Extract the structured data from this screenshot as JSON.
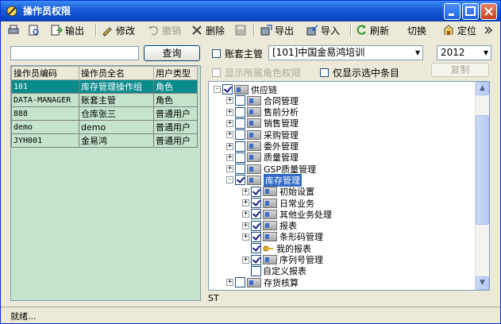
{
  "window": {
    "title": "操作员权限"
  },
  "toolbar": {
    "items": [
      {
        "label": "",
        "icon": "printer-icon"
      },
      {
        "label": "",
        "icon": "preview-icon"
      },
      {
        "label": "输出",
        "icon": "output-icon"
      },
      {
        "label": "修改",
        "icon": "edit-icon"
      },
      {
        "label": "撤销",
        "icon": "undo-icon"
      },
      {
        "label": "删除",
        "icon": "delete-icon"
      },
      {
        "label": "",
        "icon": "save-icon"
      },
      {
        "label": "导出",
        "icon": "export-icon"
      },
      {
        "label": "导入",
        "icon": "import-icon"
      },
      {
        "label": "刷新",
        "icon": "refresh-icon"
      },
      {
        "label": "切换",
        "icon": ""
      },
      {
        "label": "定位",
        "icon": "locate-icon"
      }
    ]
  },
  "left": {
    "search_value": "",
    "search_button": "查询",
    "columns": [
      "操作员编码",
      "操作员全名",
      "用户类型"
    ],
    "rows": [
      [
        "101",
        "库存管理操作组",
        "角色"
      ],
      [
        "DATA-MANAGER",
        "账套主管",
        "角色"
      ],
      [
        "888",
        "仓库张三",
        "普通用户"
      ],
      [
        "demo",
        "demo",
        "普通用户"
      ],
      [
        "JYH001",
        "金易鸿",
        "普通用户"
      ]
    ],
    "selected_index": 0
  },
  "right": {
    "account_master_label": "账套主管",
    "account_select": "[101]中国金易鸿培训",
    "year_select": "2012",
    "show_role_perms_label": "显示所属角色权限",
    "show_selected_only_label": "仅显示选中条目",
    "copy_button": "复制",
    "tree": [
      {
        "label": "供应链",
        "level": 0,
        "expander": "-",
        "checked": true
      },
      {
        "label": "合同管理",
        "level": 1,
        "expander": "+",
        "checked": false
      },
      {
        "label": "售前分析",
        "level": 1,
        "expander": "+",
        "checked": false
      },
      {
        "label": "销售管理",
        "level": 1,
        "expander": "+",
        "checked": false
      },
      {
        "label": "采购管理",
        "level": 1,
        "expander": "+",
        "checked": false
      },
      {
        "label": "委外管理",
        "level": 1,
        "expander": "+",
        "checked": false
      },
      {
        "label": "质量管理",
        "level": 1,
        "expander": "+",
        "checked": false
      },
      {
        "label": "GSP质量管理",
        "level": 1,
        "expander": "+",
        "checked": false
      },
      {
        "label": "库存管理",
        "level": 1,
        "expander": "-",
        "checked": true,
        "selected": true
      },
      {
        "label": "初始设置",
        "level": 2,
        "expander": "+",
        "checked": true
      },
      {
        "label": "日常业务",
        "level": 2,
        "expander": "+",
        "checked": true
      },
      {
        "label": "其他业务处理",
        "level": 2,
        "expander": "+",
        "checked": true
      },
      {
        "label": "报表",
        "level": 2,
        "expander": "+",
        "checked": true
      },
      {
        "label": "条形码管理",
        "level": 2,
        "expander": "+",
        "checked": true
      },
      {
        "label": "我的报表",
        "level": 2,
        "expander": "",
        "checked": true,
        "icon": "key"
      },
      {
        "label": "序列号管理",
        "level": 2,
        "expander": "+",
        "checked": true
      },
      {
        "label": "自定义报表",
        "level": 2,
        "expander": "",
        "checked": false,
        "icon": "none"
      },
      {
        "label": "存货核算",
        "level": 1,
        "expander": "+",
        "checked": false
      }
    ],
    "bottom_text": "ST"
  },
  "status": {
    "text": "就绪..."
  }
}
